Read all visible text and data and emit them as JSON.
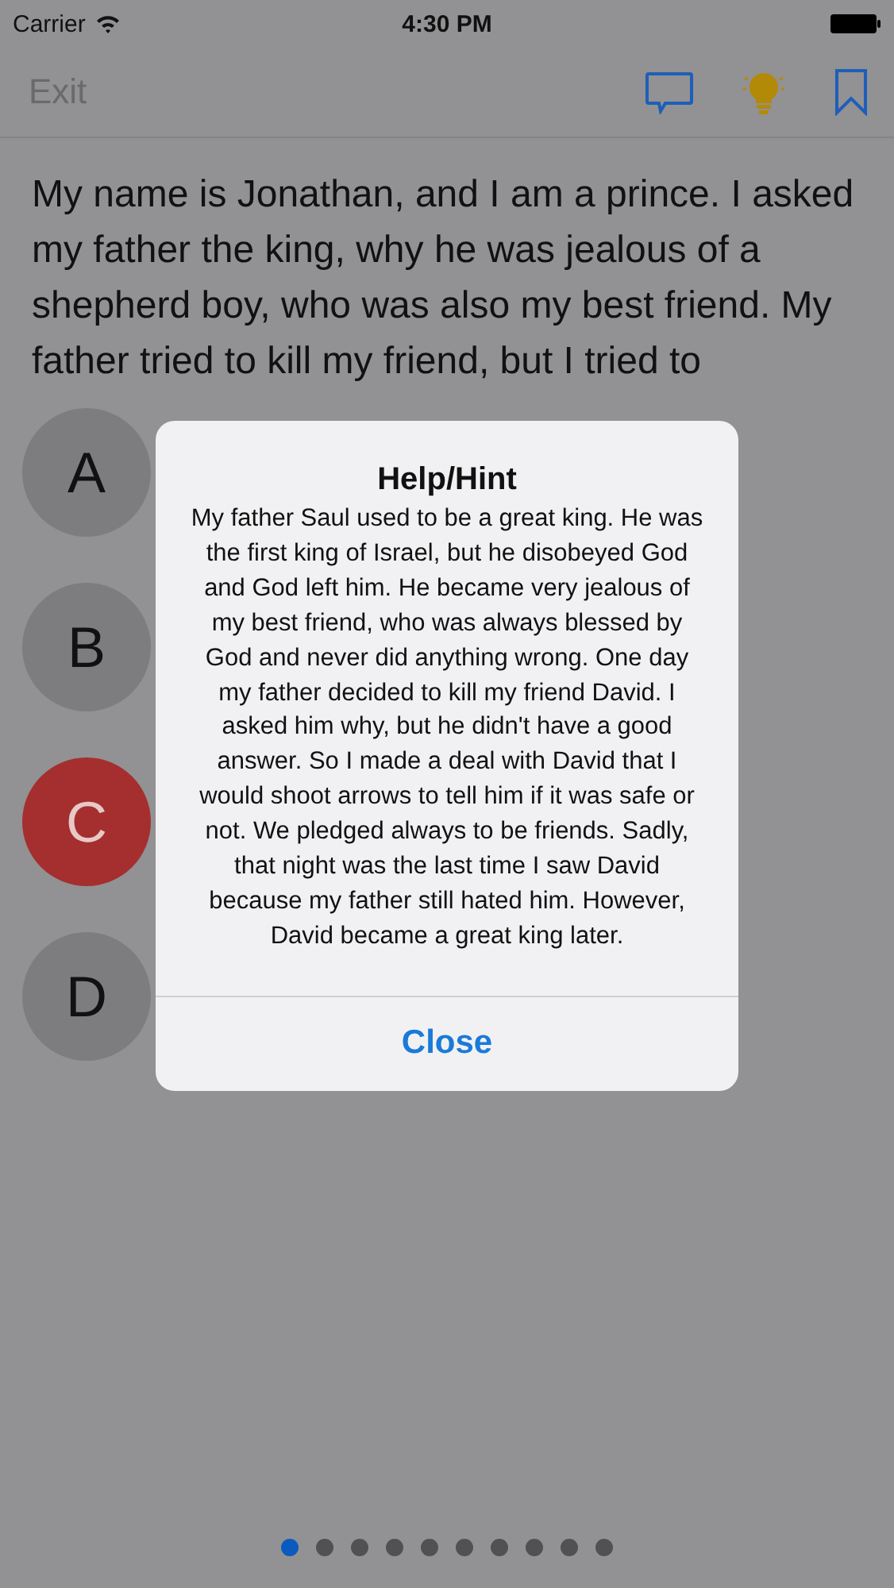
{
  "status_bar": {
    "carrier": "Carrier",
    "time": "4:30 PM"
  },
  "nav_bar": {
    "exit": "Exit"
  },
  "question": "My name is Jonathan, and I am a prince. I asked my father the king, why he was jealous of a shepherd boy, who was also my best friend. My father tried to kill my friend, but I tried to",
  "answers": [
    {
      "label": "A",
      "selected": false
    },
    {
      "label": "B",
      "selected": false
    },
    {
      "label": "C",
      "selected": true
    },
    {
      "label": "D",
      "selected": false
    }
  ],
  "dialog": {
    "title": "Help/Hint",
    "body": "My father Saul used to be a great king. He was the first king of Israel, but he disobeyed God and God left him. He became very jealous of my best friend, who was always blessed by God and never did anything wrong. One day my father decided to kill my friend David. I asked him why, but he didn't have a good answer. So I made a deal with David that I would shoot arrows to tell him if it was safe or not. We pledged always to be friends. Sadly, that night was the last time I saw David because my father still hated him. However, David became a great king later.",
    "button": "Close"
  },
  "pages": [
    {
      "selected": true
    },
    {
      "selected": false
    },
    {
      "selected": false
    },
    {
      "selected": false
    },
    {
      "selected": false
    },
    {
      "selected": false
    },
    {
      "selected": false
    },
    {
      "selected": false
    },
    {
      "selected": false
    },
    {
      "selected": false
    }
  ]
}
